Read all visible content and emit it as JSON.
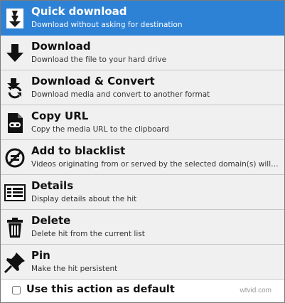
{
  "menu": {
    "items": [
      {
        "title": "Quick download",
        "desc": "Download without asking for destination",
        "icon": "quick-download-icon"
      },
      {
        "title": "Download",
        "desc": "Download the file to your hard drive",
        "icon": "download-arrow-icon"
      },
      {
        "title": "Download & Convert",
        "desc": "Download media and convert to another format",
        "icon": "download-convert-icon"
      },
      {
        "title": "Copy URL",
        "desc": "Copy the media URL to the clipboard",
        "icon": "copy-url-icon"
      },
      {
        "title": "Add to blacklist",
        "desc": "Videos originating from or served by the selected domain(s) will be ignor...",
        "icon": "blacklist-icon"
      },
      {
        "title": "Details",
        "desc": "Display details about the hit",
        "icon": "details-icon"
      },
      {
        "title": "Delete",
        "desc": "Delete hit from the current list",
        "icon": "trash-icon"
      },
      {
        "title": "Pin",
        "desc": "Make the hit persistent",
        "icon": "pin-icon"
      }
    ],
    "selected_index": 0
  },
  "footer": {
    "checkbox_label": "Use this action as default",
    "checked": false
  },
  "watermark": "wtvid.com",
  "colors": {
    "selected_bg": "#2e82d6",
    "item_bg": "#f0f0f0"
  }
}
